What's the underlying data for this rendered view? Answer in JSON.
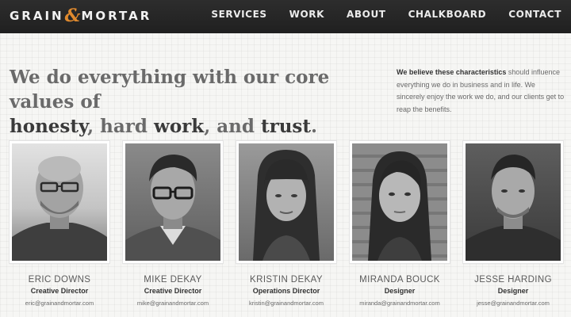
{
  "brand": {
    "part1": "GRAIN",
    "amp": "&",
    "part2": "MORTAR"
  },
  "nav": [
    "SERVICES",
    "WORK",
    "ABOUT",
    "CHALKBOARD",
    "CONTACT"
  ],
  "headline": {
    "t1": "We do everything with our core values of",
    "b1": "honesty",
    "t2": ", hard ",
    "b2": "work",
    "t3": ", and ",
    "b3": "trust",
    "t4": "."
  },
  "side_text": {
    "bold": "We believe these characteristics",
    "rest": " should influence everything we do in business and in life. We sincerely enjoy the work we do, and our clients get to reap the benefits."
  },
  "team": [
    {
      "name": "ERIC DOWNS",
      "role": "Creative Director",
      "email": "eric@grainandmortar.com"
    },
    {
      "name": "MIKE DEKAY",
      "role": "Creative Director",
      "email": "mike@grainandmortar.com"
    },
    {
      "name": "KRISTIN DEKAY",
      "role": "Operations Director",
      "email": "kristin@grainandmortar.com"
    },
    {
      "name": "MIRANDA BOUCK",
      "role": "Designer",
      "email": "miranda@grainandmortar.com"
    },
    {
      "name": "JESSE HARDING",
      "role": "Designer",
      "email": "jesse@grainandmortar.com"
    }
  ]
}
